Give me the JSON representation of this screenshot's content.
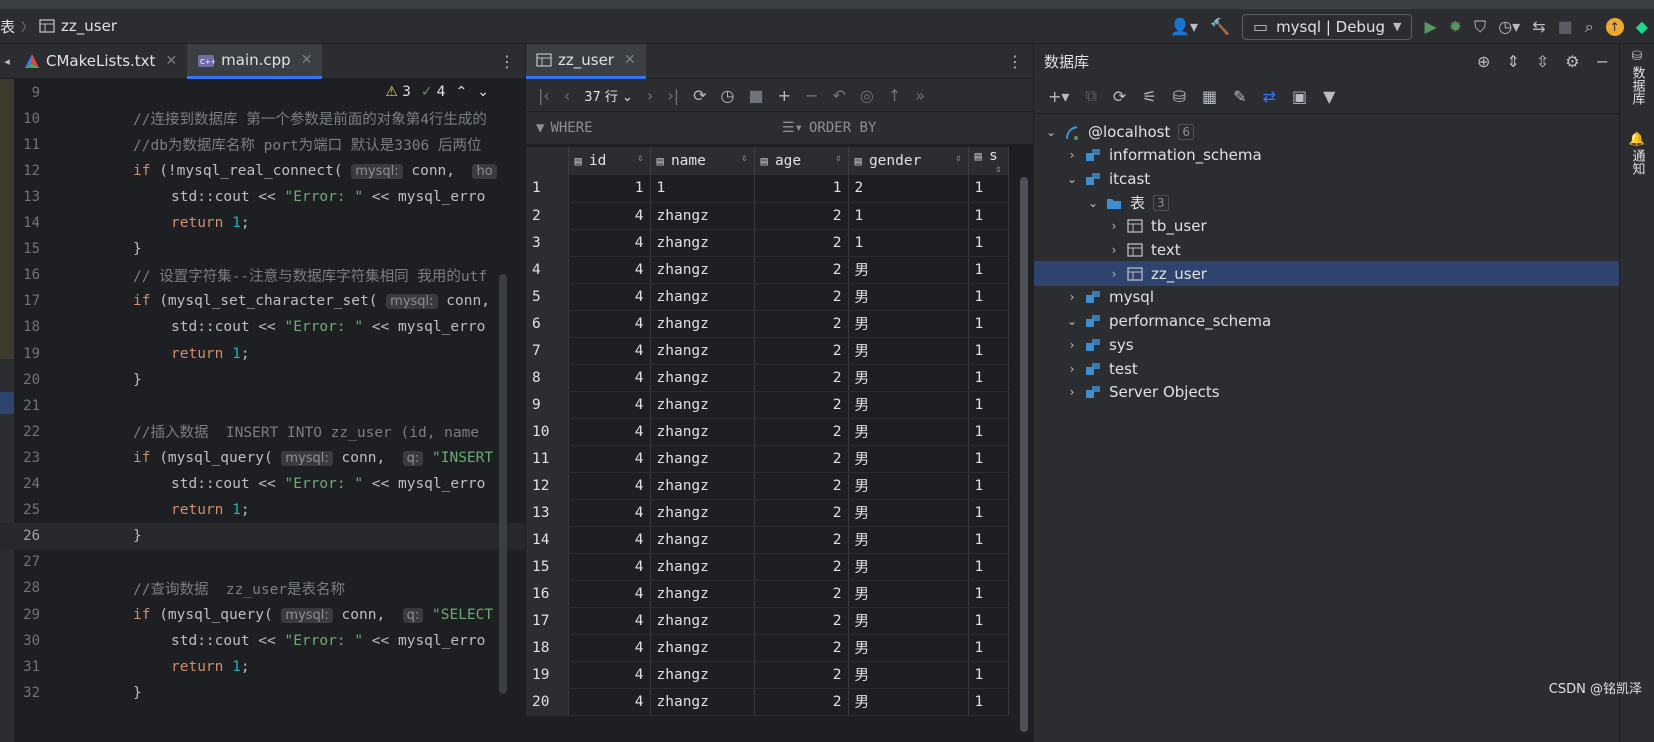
{
  "topbar": {
    "breadcrumb_prefix": "表",
    "breadcrumb_table": "zz_user",
    "run_config": "mysql | Debug"
  },
  "editor": {
    "tabs": [
      {
        "label": "CMakeLists.txt",
        "icon": "cmake-icon"
      },
      {
        "label": "main.cpp",
        "icon": "cpp-file-icon",
        "active": true
      }
    ],
    "inspection": {
      "warnings": "3",
      "typos": "4"
    },
    "lines": [
      {
        "n": "9",
        "html": ""
      },
      {
        "n": "10",
        "parts": [
          [
            "cm",
            "//连接到数据库 第一个参数是前面的对象第4行生成的"
          ]
        ]
      },
      {
        "n": "11",
        "parts": [
          [
            "cm",
            "//db为数据库名称 port为端口 默认是3306 后两位"
          ]
        ]
      },
      {
        "n": "12",
        "parts": [
          [
            "kw",
            "if"
          ],
          [
            "",
            " (!mysql_real_connect( "
          ],
          [
            "hint",
            "mysql:"
          ],
          [
            "",
            " conn,  "
          ],
          [
            "hint",
            "ho"
          ]
        ]
      },
      {
        "n": "13",
        "indent": 1,
        "parts": [
          [
            "",
            "std::cout << "
          ],
          [
            "st",
            "\"Error: \""
          ],
          [
            "",
            " << mysql_erro"
          ]
        ]
      },
      {
        "n": "14",
        "indent": 1,
        "parts": [
          [
            "kw",
            "return"
          ],
          [
            "",
            " "
          ],
          [
            "num",
            "1"
          ],
          [
            "",
            ";"
          ]
        ]
      },
      {
        "n": "15",
        "parts": [
          [
            "",
            "}"
          ]
        ]
      },
      {
        "n": "16",
        "parts": [
          [
            "cm",
            "// 设置字符集--注意与数据库字符集相同 我用的utf"
          ]
        ]
      },
      {
        "n": "17",
        "parts": [
          [
            "kw",
            "if"
          ],
          [
            "",
            " (mysql_set_character_set( "
          ],
          [
            "hint",
            "mysql:"
          ],
          [
            "",
            " conn,"
          ]
        ]
      },
      {
        "n": "18",
        "indent": 1,
        "parts": [
          [
            "",
            "std::cout << "
          ],
          [
            "st",
            "\"Error: \""
          ],
          [
            "",
            " << mysql_erro"
          ]
        ]
      },
      {
        "n": "19",
        "indent": 1,
        "parts": [
          [
            "kw",
            "return"
          ],
          [
            "",
            " "
          ],
          [
            "num",
            "1"
          ],
          [
            "",
            ";"
          ]
        ]
      },
      {
        "n": "20",
        "parts": [
          [
            "",
            "}"
          ]
        ]
      },
      {
        "n": "21",
        "parts": []
      },
      {
        "n": "22",
        "parts": [
          [
            "cm",
            "//插入数据  INSERT INTO zz_user (id, name"
          ]
        ]
      },
      {
        "n": "23",
        "parts": [
          [
            "kw",
            "if"
          ],
          [
            "",
            " (mysql_query( "
          ],
          [
            "hint",
            "mysql:"
          ],
          [
            "",
            " conn,  "
          ],
          [
            "hint",
            "q:"
          ],
          [
            "st",
            " \"INSERT"
          ]
        ]
      },
      {
        "n": "24",
        "indent": 1,
        "parts": [
          [
            "",
            "std::cout << "
          ],
          [
            "st",
            "\"Error: \""
          ],
          [
            "",
            " << mysql_erro"
          ]
        ]
      },
      {
        "n": "25",
        "indent": 1,
        "parts": [
          [
            "kw",
            "return"
          ],
          [
            "",
            " "
          ],
          [
            "num",
            "1"
          ],
          [
            "",
            ";"
          ]
        ]
      },
      {
        "n": "26",
        "parts": [
          [
            "",
            "}"
          ]
        ],
        "current": true
      },
      {
        "n": "27",
        "parts": []
      },
      {
        "n": "28",
        "parts": [
          [
            "cm",
            "//查询数据  zz_user是表名称"
          ]
        ]
      },
      {
        "n": "29",
        "parts": [
          [
            "kw",
            "if"
          ],
          [
            "",
            " (mysql_query( "
          ],
          [
            "hint",
            "mysql:"
          ],
          [
            "",
            " conn,  "
          ],
          [
            "hint",
            "q:"
          ],
          [
            "st",
            " \"SELECT"
          ]
        ]
      },
      {
        "n": "30",
        "indent": 1,
        "parts": [
          [
            "",
            "std::cout << "
          ],
          [
            "st",
            "\"Error: \""
          ],
          [
            "",
            " << mysql_erro"
          ]
        ]
      },
      {
        "n": "31",
        "indent": 1,
        "parts": [
          [
            "kw",
            "return"
          ],
          [
            "",
            " "
          ],
          [
            "num",
            "1"
          ],
          [
            "",
            ";"
          ]
        ]
      },
      {
        "n": "32",
        "parts": [
          [
            "",
            "}"
          ]
        ]
      }
    ]
  },
  "table_view": {
    "tab_label": "zz_user",
    "row_count": "37 行",
    "where_label": "WHERE",
    "orderby_label": "ORDER BY",
    "columns": [
      "id",
      "name",
      "age",
      "gender",
      "s"
    ],
    "rows": [
      [
        "1",
        "1",
        "1",
        "1",
        "2",
        "1"
      ],
      [
        "2",
        "4",
        "zhangz",
        "2",
        "1",
        "1"
      ],
      [
        "3",
        "4",
        "zhangz",
        "2",
        "1",
        "1"
      ],
      [
        "4",
        "4",
        "zhangz",
        "2",
        "男",
        "1"
      ],
      [
        "5",
        "4",
        "zhangz",
        "2",
        "男",
        "1"
      ],
      [
        "6",
        "4",
        "zhangz",
        "2",
        "男",
        "1"
      ],
      [
        "7",
        "4",
        "zhangz",
        "2",
        "男",
        "1"
      ],
      [
        "8",
        "4",
        "zhangz",
        "2",
        "男",
        "1"
      ],
      [
        "9",
        "4",
        "zhangz",
        "2",
        "男",
        "1"
      ],
      [
        "10",
        "4",
        "zhangz",
        "2",
        "男",
        "1"
      ],
      [
        "11",
        "4",
        "zhangz",
        "2",
        "男",
        "1"
      ],
      [
        "12",
        "4",
        "zhangz",
        "2",
        "男",
        "1"
      ],
      [
        "13",
        "4",
        "zhangz",
        "2",
        "男",
        "1"
      ],
      [
        "14",
        "4",
        "zhangz",
        "2",
        "男",
        "1"
      ],
      [
        "15",
        "4",
        "zhangz",
        "2",
        "男",
        "1"
      ],
      [
        "16",
        "4",
        "zhangz",
        "2",
        "男",
        "1"
      ],
      [
        "17",
        "4",
        "zhangz",
        "2",
        "男",
        "1"
      ],
      [
        "18",
        "4",
        "zhangz",
        "2",
        "男",
        "1"
      ],
      [
        "19",
        "4",
        "zhangz",
        "2",
        "男",
        "1"
      ],
      [
        "20",
        "4",
        "zhangz",
        "2",
        "男",
        "1"
      ]
    ]
  },
  "database": {
    "title": "数据库",
    "tree": [
      {
        "label": "@localhost",
        "badge": "6",
        "depth": 0,
        "open": true,
        "kind": "host"
      },
      {
        "label": "information_schema",
        "depth": 1,
        "open": false,
        "kind": "schema"
      },
      {
        "label": "itcast",
        "depth": 1,
        "open": true,
        "kind": "schema"
      },
      {
        "label": "表",
        "badge": "3",
        "depth": 2,
        "open": true,
        "kind": "folder"
      },
      {
        "label": "tb_user",
        "depth": 3,
        "open": false,
        "kind": "table"
      },
      {
        "label": "text",
        "depth": 3,
        "open": false,
        "kind": "table"
      },
      {
        "label": "zz_user",
        "depth": 3,
        "open": false,
        "kind": "table",
        "selected": true
      },
      {
        "label": "mysql",
        "depth": 1,
        "open": false,
        "kind": "schema"
      },
      {
        "label": "performance_schema",
        "depth": 1,
        "open": true,
        "kind": "schema"
      },
      {
        "label": "sys",
        "depth": 1,
        "open": false,
        "kind": "schema"
      },
      {
        "label": "test",
        "depth": 1,
        "open": false,
        "kind": "schema"
      },
      {
        "label": "Server Objects",
        "depth": 1,
        "open": false,
        "kind": "server"
      }
    ]
  },
  "right_strip": {
    "db_label": "数据库",
    "notify_label": "通知"
  },
  "watermark": "CSDN @铭凯泽",
  "colors": {
    "accent": "#3574f0",
    "selection": "#2e436e",
    "keyword": "#cf8e6d",
    "string": "#6aab73",
    "comment": "#7a7e85",
    "number": "#2aacb8"
  }
}
